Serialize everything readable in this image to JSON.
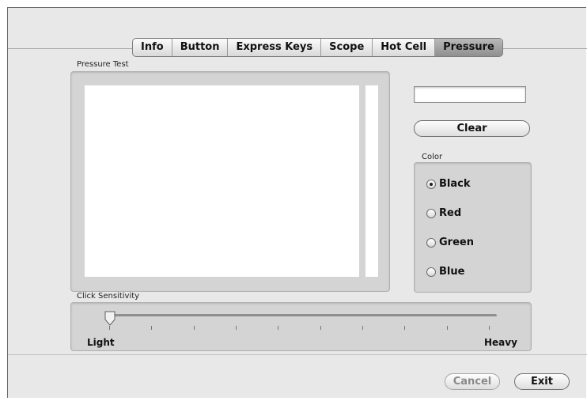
{
  "tabs": [
    {
      "label": "Info",
      "active": false
    },
    {
      "label": "Button",
      "active": false
    },
    {
      "label": "Express Keys",
      "active": false
    },
    {
      "label": "Scope",
      "active": false
    },
    {
      "label": "Hot Cell",
      "active": false
    },
    {
      "label": "Pressure",
      "active": true
    }
  ],
  "pressure_test": {
    "label": "Pressure Test",
    "value_field": "",
    "clear_label": "Clear"
  },
  "color": {
    "label": "Color",
    "options": [
      {
        "label": "Black",
        "selected": true
      },
      {
        "label": "Red",
        "selected": false
      },
      {
        "label": "Green",
        "selected": false
      },
      {
        "label": "Blue",
        "selected": false
      }
    ]
  },
  "click_sensitivity": {
    "label": "Click Sensitivity",
    "min_label": "Light",
    "max_label": "Heavy",
    "value_fraction": 0.0,
    "tick_count": 10
  },
  "footer": {
    "cancel_label": "Cancel",
    "exit_label": "Exit"
  }
}
